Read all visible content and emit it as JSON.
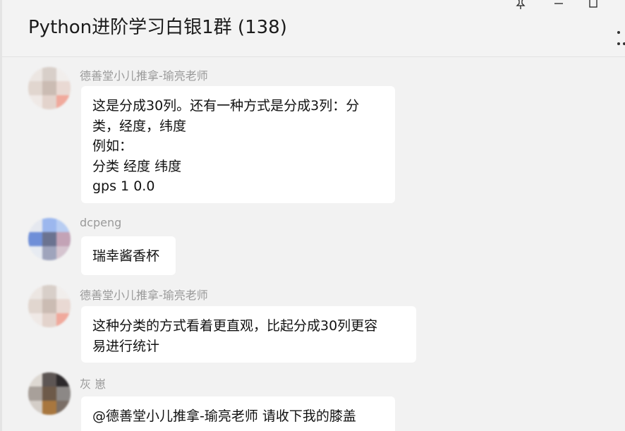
{
  "window": {
    "title": "Python进阶学习白银1群 (138)",
    "controls": {
      "pin_icon": "pin-icon",
      "minimize_icon": "minimize-icon",
      "maximize_icon": "maximize-icon",
      "more_icon": "more-icon"
    }
  },
  "messages": [
    {
      "sender": "德善堂小儿推拿-瑜亮老师",
      "lines": [
        "这是分成30列。还有一种方式是分成3列：分",
        "类，经度，纬度",
        "例如：",
        "分类 经度 纬度",
        "gps 1 0.0"
      ]
    },
    {
      "sender": "dcpeng",
      "lines": [
        "瑞幸酱香杯"
      ]
    },
    {
      "sender": "德善堂小儿推拿-瑜亮老师",
      "lines": [
        "这种分类的方式看着更直观，比起分成30列更容",
        "易进行统计"
      ]
    },
    {
      "sender": "灰 崽",
      "lines": [
        "@德善堂小儿推拿-瑜亮老师 请收下我的膝盖"
      ]
    }
  ],
  "colors": {
    "background": "#f2f2f2",
    "bubble": "#ffffff",
    "sender_name": "#9a9a9a",
    "text": "#111111"
  }
}
